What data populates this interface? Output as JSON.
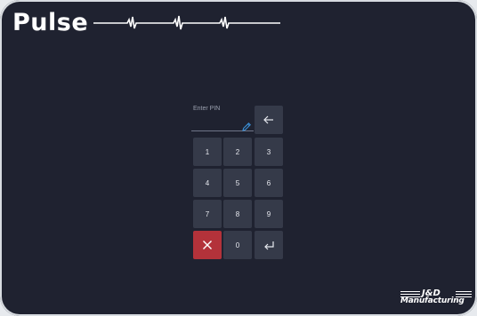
{
  "brand": {
    "title": "Pulse",
    "pulse_icon": "heartbeat-line"
  },
  "pin": {
    "label": "Enter PIN",
    "value": "",
    "placeholder": "",
    "edit_icon": "pencil-icon"
  },
  "keypad": {
    "keys": [
      "1",
      "2",
      "3",
      "4",
      "5",
      "6",
      "7",
      "8",
      "9",
      "0"
    ],
    "backspace_icon": "arrow-left-icon",
    "cancel_icon": "x-icon",
    "enter_icon": "enter-icon"
  },
  "logo": {
    "line1": "J&D",
    "line2": "Manufacturing"
  },
  "colors": {
    "background": "#1f2230",
    "key": "#353a49",
    "cancel": "#b3323a",
    "accent": "#3a8fd6"
  }
}
